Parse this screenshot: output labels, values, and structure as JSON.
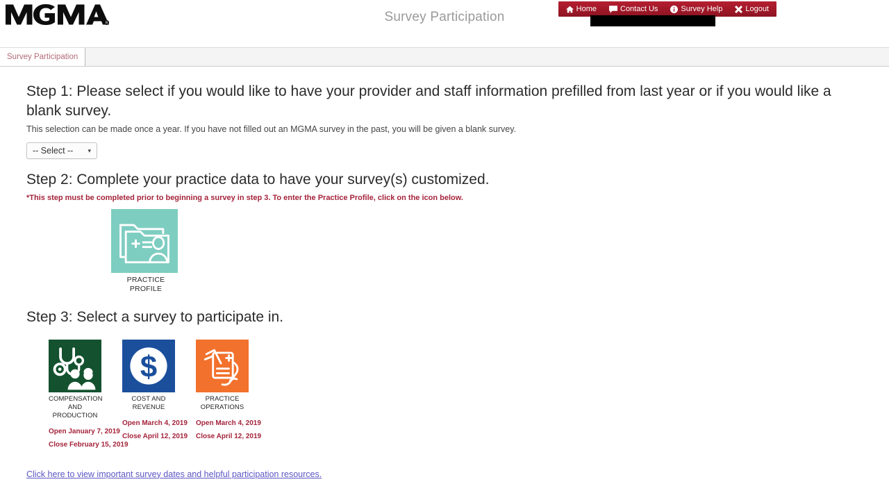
{
  "header": {
    "logo_text": "MGMA",
    "logo_name": "mgma-logo",
    "page_title": "Survey Participation",
    "nav": [
      {
        "label": "Home",
        "icon": "home-icon"
      },
      {
        "label": "Contact Us",
        "icon": "comment-icon"
      },
      {
        "label": "Survey Help",
        "icon": "info-icon"
      },
      {
        "label": "Logout",
        "icon": "close-x-icon"
      }
    ],
    "nav_bg_color": "#a01828"
  },
  "tabs": [
    {
      "label": "Survey Participation",
      "active": true
    }
  ],
  "step1": {
    "heading": "Step 1: Please select if you would like to have your provider and staff information prefilled from last year or if you would like a blank survey.",
    "subtext": "This selection can be made once a year. If you have not filled out an MGMA survey in the past, you will be given a blank survey.",
    "select_value": "-- Select --",
    "select_caret": "▾"
  },
  "step2": {
    "heading": "Step 2: Complete your practice data to have your survey(s) customized.",
    "note": "*This step must be completed prior to beginning a survey in step 3. To enter the Practice Profile, click on the icon below.",
    "tile": {
      "line1": "PRACTICE",
      "line2": "PROFILE",
      "color": "#7ecdc1",
      "icon": "folder-person-icon"
    }
  },
  "step3": {
    "heading": "Step 3: Select a survey to participate in.",
    "surveys": [
      {
        "name_line1": "COMPENSATION",
        "name_line2": "AND PRODUCTION",
        "open": "Open January 7, 2019",
        "close": "Close February 15, 2019",
        "color": "#14522f",
        "icon": "stethoscope-providers-icon"
      },
      {
        "name_line1": "COST AND",
        "name_line2": "REVENUE",
        "open": "Open March 4, 2019",
        "close": "Close April 12, 2019",
        "color": "#1b4f9c",
        "icon": "dollar-circle-icon"
      },
      {
        "name_line1": "PRACTICE",
        "name_line2": "OPERATIONS",
        "open": "Open March 4, 2019",
        "close": "Close April 12, 2019",
        "color": "#f2712c",
        "icon": "clipboard-hand-icon"
      }
    ]
  },
  "footer": {
    "link_text": "Click here to view important survey dates and helpful participation resources.",
    "link_color": "#5b57c4"
  }
}
